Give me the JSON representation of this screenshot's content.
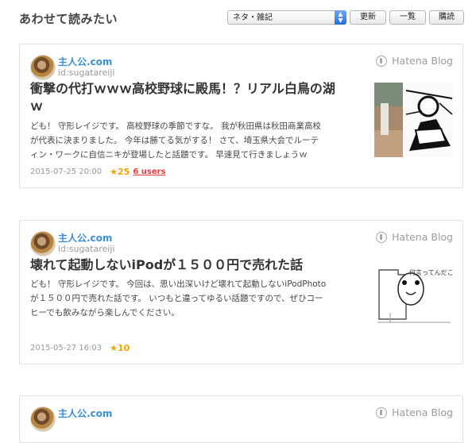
{
  "header": {
    "heading": "あわせて読みたい",
    "select_value": "ネタ・雑記",
    "refresh_label": "更新",
    "list_label": "一覧",
    "subscribe_label": "購読"
  },
  "cards": [
    {
      "author": "主人公.com",
      "userid": "id:sugatareiji",
      "brand": "Hatena Blog",
      "title_line1": "衝撃の代打ｗｗｗ高校野球に殿馬！？リアル白鳥の湖",
      "title_line2": "ｗ",
      "excerpt_line1": "ども！ 守形レイジです。 高校野球の季節ですな。 我が秋田県は秋田商業高校",
      "excerpt_line2": "が代表に決まりました。 今年は勝てる気がする！ さて、埼玉県大会でルーテ",
      "excerpt_line3": "ィン・ワークに自信ニキが登場したと話題です。 早速見て行きましょうｗ",
      "date": "2015-07-25 20:00",
      "stars": "25",
      "users": "6 users"
    },
    {
      "author": "主人公.com",
      "userid": "id:sugatareiji",
      "brand": "Hatena Blog",
      "title_line1": "壊れて起動しないiPodが１５００円で売れた話",
      "excerpt_line1": "ども！ 守形レイジです。 今回は、思い出深いけど壊れて起動しないiPodPhoto",
      "excerpt_line2": "が１５００円で売れた話です。 いつもと違ってゆるい話題ですので、ぜひコー",
      "excerpt_line3": "ヒーでも飲みながら楽しんでください。",
      "date": "2015-05-27 16:03",
      "stars": "10",
      "thumb_caption": "何言ってんだこ"
    },
    {
      "author": "主人公.com",
      "brand": "Hatena Blog"
    }
  ]
}
